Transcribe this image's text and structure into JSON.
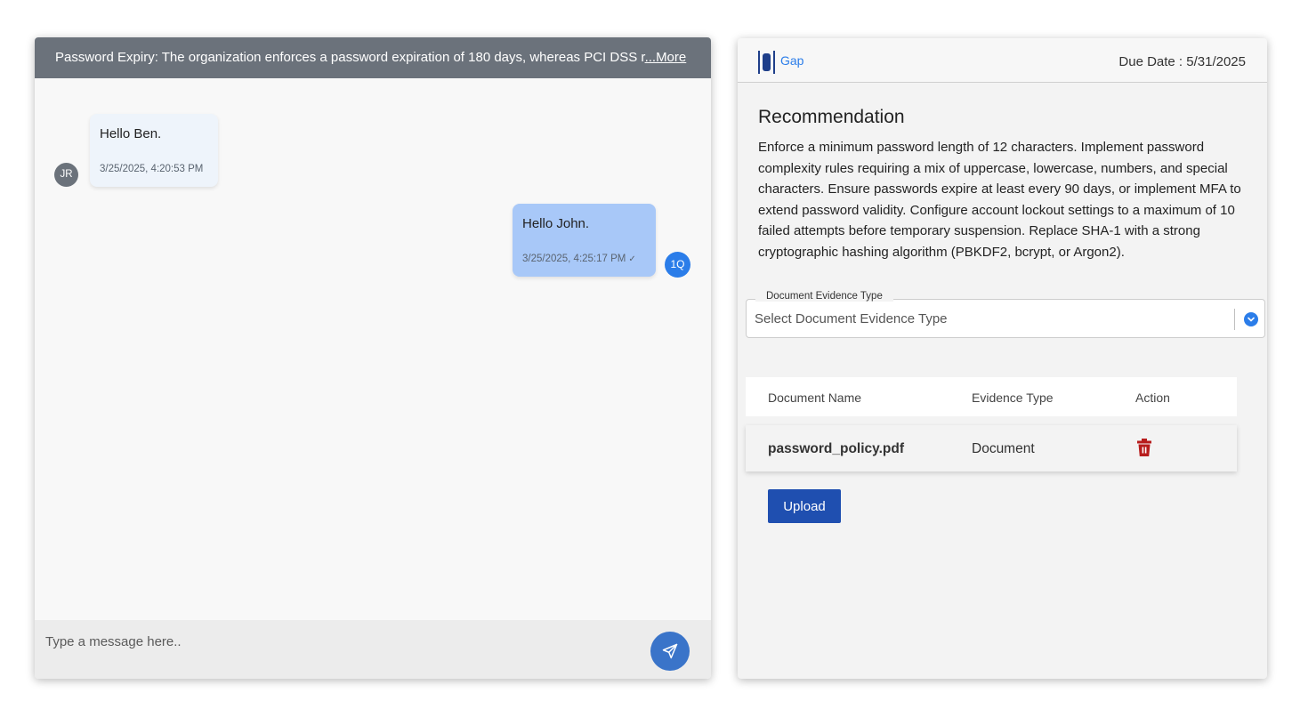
{
  "chat": {
    "header_text": "Password Expiry: The organization enforces a password expiration of 180 days, whereas PCI DSS r",
    "more_link": "...More",
    "messages": [
      {
        "author_initials": "JR",
        "text": "Hello Ben.",
        "time": "3/25/2025, 4:20:53 PM",
        "side": "left"
      },
      {
        "author_initials": "1Q",
        "text": "Hello John.",
        "time": "3/25/2025, 4:25:17 PM",
        "side": "right",
        "status": "✓"
      }
    ],
    "composer_placeholder": "Type a message here.."
  },
  "gap": {
    "title": "Gap",
    "due_date": "Due Date : 5/31/2025",
    "recommendation_title": "Recommendation",
    "recommendation_body": "Enforce a minimum password length of 12 characters. Implement password complexity rules requiring a mix of uppercase, lowercase, numbers, and special characters. Ensure passwords expire at least every 90 days, or implement MFA to extend password validity. Configure account lockout settings to a maximum of 10 failed attempts before temporary suspension. Replace SHA-1 with a strong cryptographic hashing algorithm (PBKDF2, bcrypt, or Argon2).",
    "evidence_select": {
      "label": "Document Evidence Type",
      "placeholder": "Select Document Evidence Type"
    },
    "table": {
      "headers": [
        "Document Name",
        "Evidence Type",
        "Action"
      ],
      "rows": [
        {
          "name": "password_policy.pdf",
          "type": "Document"
        }
      ]
    },
    "upload_label": "Upload"
  },
  "colors": {
    "accent": "#2b7de9",
    "header_gray": "#6b727b",
    "upload_blue": "#1f4fb0",
    "delete_red": "#b71c1c",
    "bubble_blue": "#a8c8f8"
  }
}
